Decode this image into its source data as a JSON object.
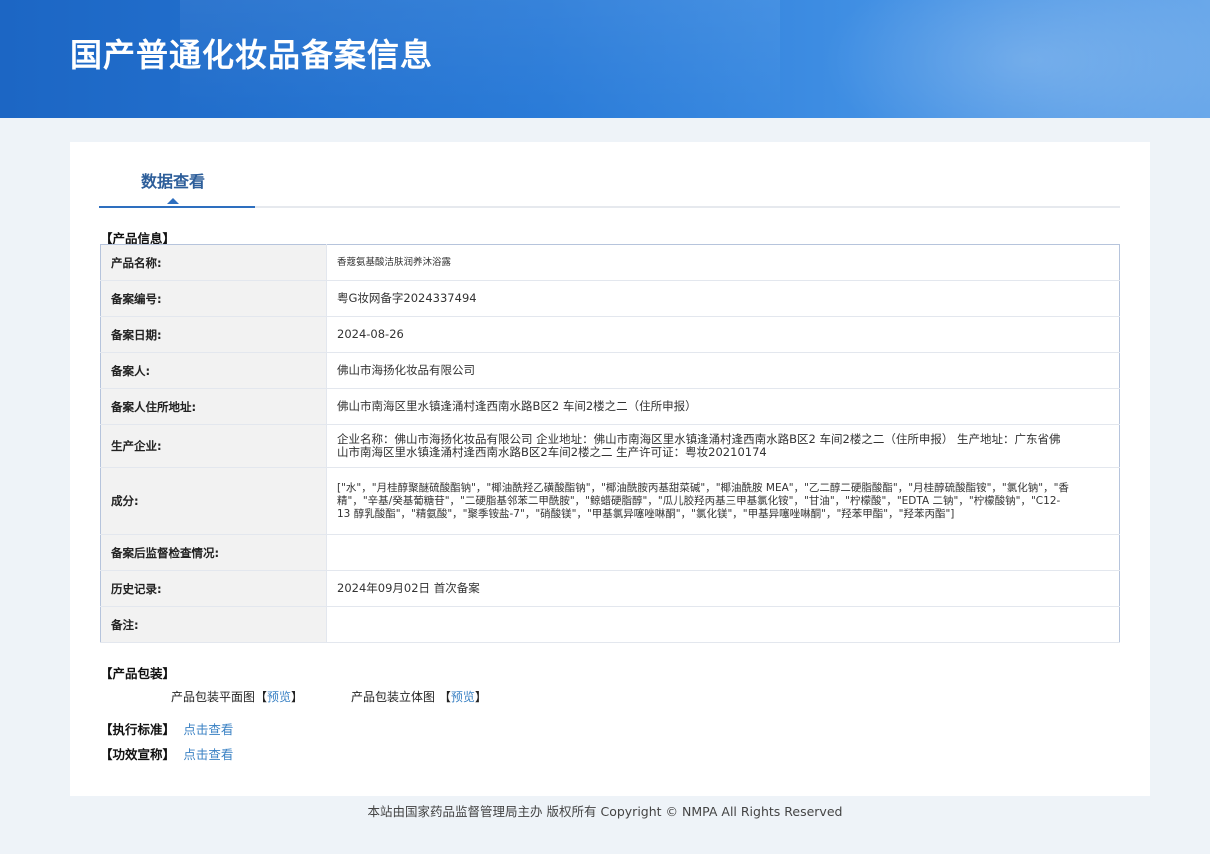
{
  "header": {
    "title": "国产普通化妆品备案信息"
  },
  "tab": {
    "label": "数据查看"
  },
  "sections": {
    "product_info": "【产品信息】",
    "packaging": "【产品包装】",
    "standard": "【执行标准】",
    "efficacy": "【功效宣称】"
  },
  "rows": [
    {
      "key": "产品名称:",
      "value": "香蔻氨基酸洁肤润养沐浴露"
    },
    {
      "key": "备案编号:",
      "value": "粤G妆网备字2024337494"
    },
    {
      "key": "备案日期:",
      "value": "2024-08-26"
    },
    {
      "key": "备案人:",
      "value": "佛山市海扬化妆品有限公司"
    },
    {
      "key": "备案人住所地址:",
      "value": "佛山市南海区里水镇逢涌村逢西南水路B区2 车间2楼之二（住所申报）"
    },
    {
      "key": "生产企业:",
      "value": "企业名称：佛山市海扬化妆品有限公司 企业地址：佛山市南海区里水镇逢涌村逢西南水路B区2 车间2楼之二（住所申报） 生产地址：广东省佛山市南海区里水镇逢涌村逢西南水路B区2车间2楼之二 生产许可证：粤妆20210174"
    },
    {
      "key": "成分:",
      "value": "[\"水\"，\"月桂醇聚醚硫酸酯钠\"，\"椰油酰羟乙磺酸酯钠\"，\"椰油酰胺丙基甜菜碱\"，\"椰油酰胺 MEA\"，\"乙二醇二硬脂酸酯\"，\"月桂醇硫酸酯铵\"，\"氯化钠\"，\"香精\"，\"辛基/癸基葡糖苷\"，\"二硬脂基邻苯二甲酰胺\"，\"鲸蜡硬脂醇\"，\"瓜儿胶羟丙基三甲基氯化铵\"，\"甘油\"，\"柠檬酸\"，\"EDTA 二钠\"，\"柠檬酸钠\"，\"C12-13 醇乳酸酯\"，\"精氨酸\"，\"聚季铵盐-7\"，\"硝酸镁\"，\"甲基氯异噻唑啉酮\"，\"氯化镁\"，\"甲基异噻唑啉酮\"，\"羟苯甲酯\"，\"羟苯丙酯\"]"
    },
    {
      "key": "备案后监督检查情况:",
      "value": ""
    },
    {
      "key": "历史记录:",
      "value": "2024年09月02日 首次备案"
    },
    {
      "key": "备注:",
      "value": ""
    }
  ],
  "packaging": {
    "flat_label": "产品包装平面图",
    "solid_label": "产品包装立体图",
    "bracket_open": "【",
    "bracket_close": "】",
    "preview": "预览"
  },
  "links": {
    "view": "点击查看"
  },
  "footer": {
    "text": "本站由国家药品监督管理局主办 版权所有 Copyright © NMPA All Rights Reserved"
  }
}
